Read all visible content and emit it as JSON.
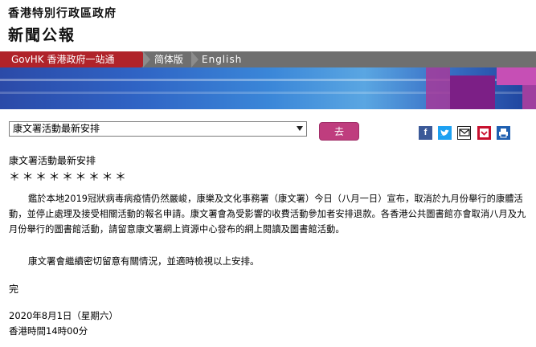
{
  "header": {
    "government_name": "香港特別行政區政府",
    "press_title": "新聞公報"
  },
  "nav": {
    "gov_portal": "GovHK 香港政府一站通",
    "simplified": "简体版",
    "english": "English"
  },
  "toolbar": {
    "select_value": "康文署活動最新安排",
    "go_label": "去",
    "share_icons": [
      "facebook-icon",
      "twitter-icon",
      "email-icon",
      "bookmark-icon",
      "print-icon"
    ]
  },
  "article": {
    "title": "康文署活動最新安排",
    "stars": "＊＊＊＊＊＊＊＊＊",
    "paragraph1": "鑑於本地2019冠狀病毒病疫情仍然嚴峻，康樂及文化事務署（康文署）今日（八月一日）宣布，取消於九月份舉行的康體活動，並停止處理及接受相關活動的報名申請。康文署會為受影響的收費活動參加者安排退款。各香港公共圖書館亦會取消八月及九月份舉行的圖書館活動，請留意康文署網上資源中心發布的網上閱讀及圖書館活動。",
    "paragraph2": "康文署會繼續密切留意有關情況，並適時檢視以上安排。",
    "end_mark": "完",
    "date": "2020年8月1日（星期六）",
    "time": "香港時間14時00分"
  },
  "colors": {
    "nav_red": "#b0232a",
    "nav_grey": "#6f6f6f",
    "go_button": "#bf3d7e"
  }
}
